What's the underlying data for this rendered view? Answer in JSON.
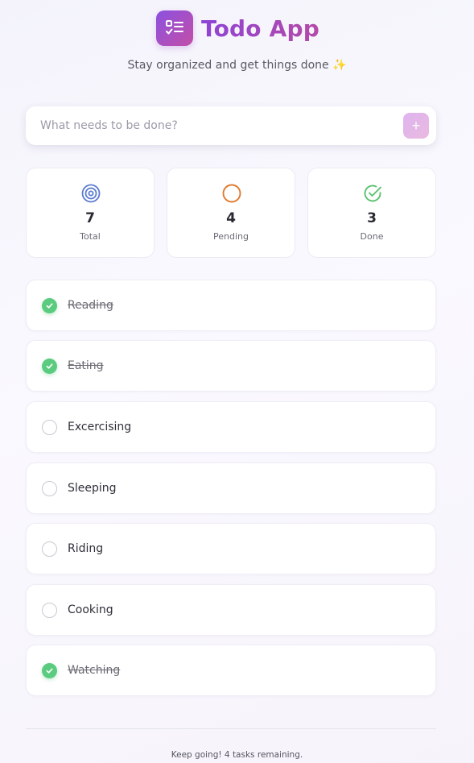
{
  "header": {
    "title": "Todo App",
    "subtitle": "Stay organized and get things done",
    "subtitle_emoji": "✨",
    "logo_icon": "checklist-icon"
  },
  "new_todo": {
    "placeholder": "What needs to be done?",
    "value": "",
    "add_label": "+"
  },
  "stats": [
    {
      "icon": "target-icon",
      "color": "#5b7ccf",
      "value": "7",
      "label": "Total"
    },
    {
      "icon": "circle-icon",
      "color": "#e07a2d",
      "value": "4",
      "label": "Pending"
    },
    {
      "icon": "check-circle-icon",
      "color": "#5bc16f",
      "value": "3",
      "label": "Done"
    }
  ],
  "todos": [
    {
      "text": "Reading",
      "done": true
    },
    {
      "text": "Eating",
      "done": true
    },
    {
      "text": "Excercising",
      "done": false
    },
    {
      "text": "Sleeping",
      "done": false
    },
    {
      "text": "Riding",
      "done": false
    },
    {
      "text": "Cooking",
      "done": false
    },
    {
      "text": "Watching",
      "done": true
    }
  ],
  "footer": {
    "text": "Keep going! 4 tasks remaining."
  },
  "colors": {
    "accent_start": "#8b50e0",
    "accent_end": "#c34fa7",
    "done_green": "#5bcb7f"
  }
}
